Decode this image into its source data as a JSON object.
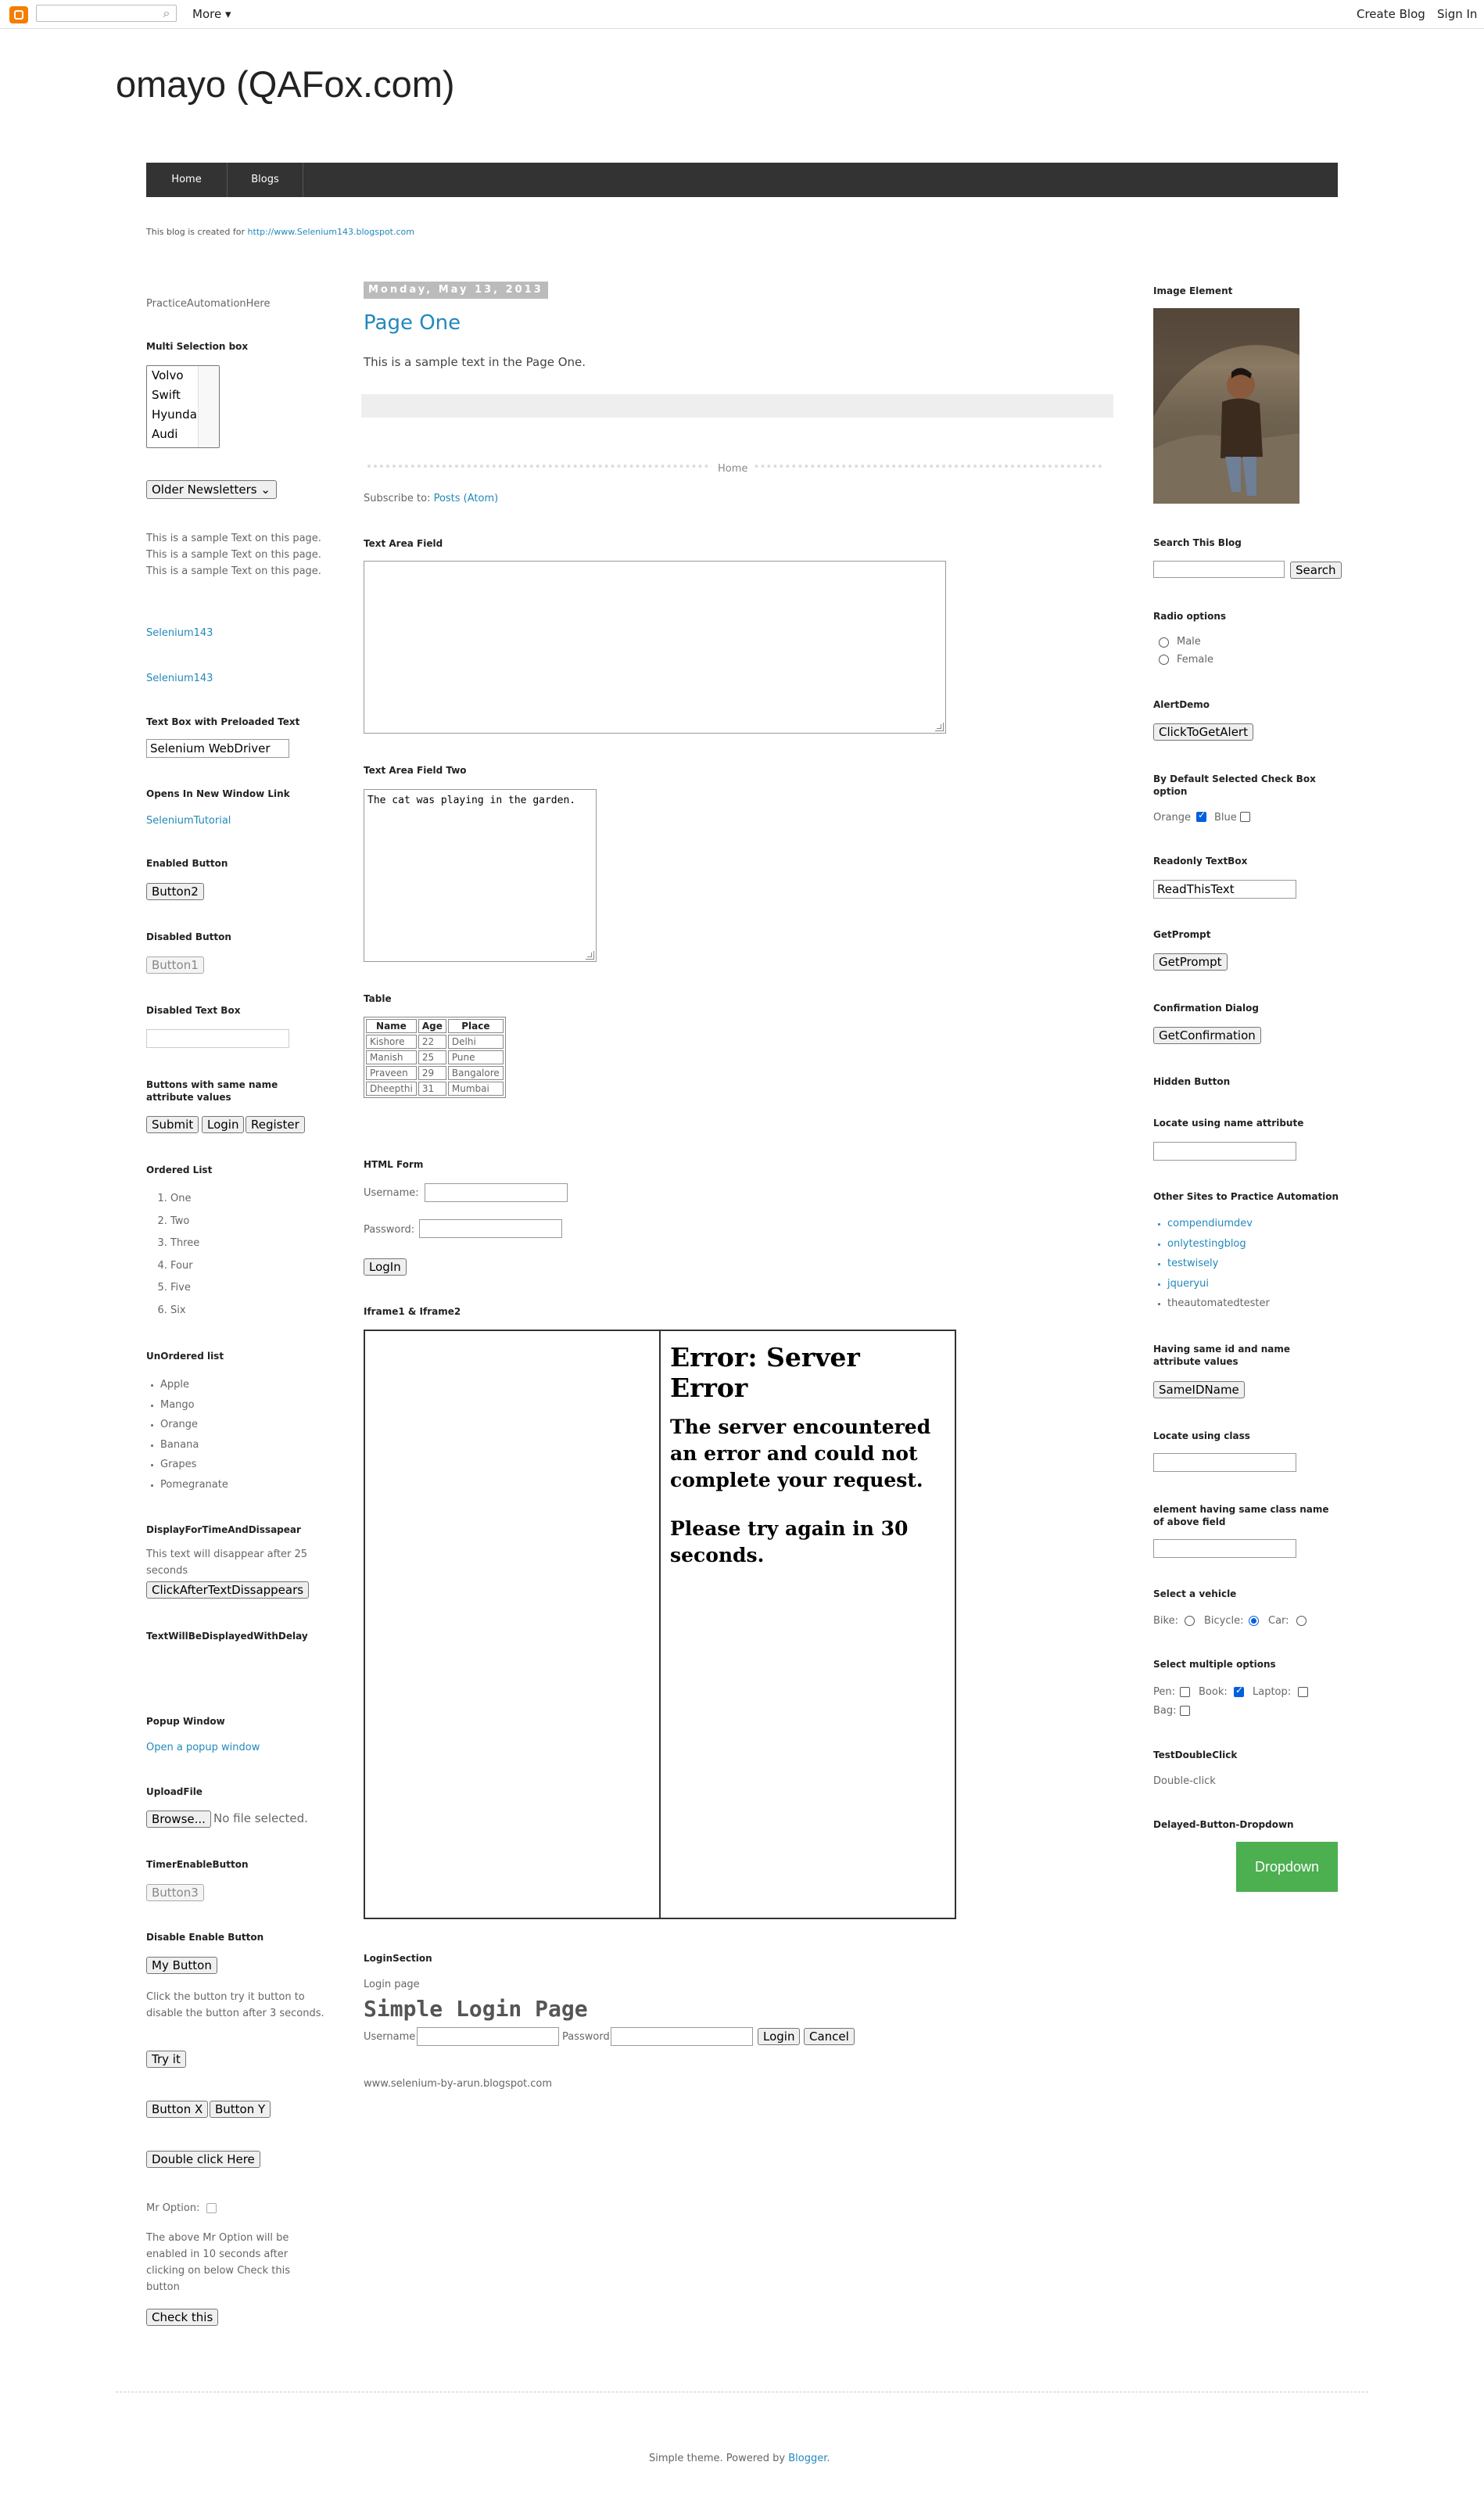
{
  "navbar": {
    "more": "More ▾",
    "create_blog": "Create Blog",
    "sign_in": "Sign In"
  },
  "header": {
    "title": "omayo (QAFox.com)"
  },
  "tabs": [
    {
      "label": "Home"
    },
    {
      "label": "Blogs"
    }
  ],
  "description": {
    "text": "This blog is created for ",
    "link": "http://www.Selenium143.blogspot.com"
  },
  "left": {
    "practice": "PracticeAutomationHere",
    "multi_select": {
      "heading": "Multi Selection box",
      "options": [
        "Volvo",
        "Swift",
        "Hyundai",
        "Audi"
      ]
    },
    "newsletters": "Older Newsletters",
    "sample_text": "This is a sample Text on this page. This is a sample Text on this page. This is a sample Text on this page.",
    "selenium143_a": "Selenium143",
    "selenium143_b": "Selenium143",
    "preloaded": {
      "heading": "Text Box with Preloaded Text",
      "value": "Selenium WebDriver"
    },
    "new_window": {
      "heading": "Opens In New Window Link",
      "link": "SeleniumTutorial"
    },
    "enabled": {
      "heading": "Enabled Button",
      "button": "Button2"
    },
    "disabled": {
      "heading": "Disabled Button",
      "button": "Button1"
    },
    "disabled_text": {
      "heading": "Disabled Text Box"
    },
    "same_name": {
      "heading": "Buttons with same name attribute values",
      "buttons": [
        "Submit",
        "Login",
        "Register"
      ]
    },
    "ordered": {
      "heading": "Ordered List",
      "items": [
        "One",
        "Two",
        "Three",
        "Four",
        "Five",
        "Six"
      ]
    },
    "unordered": {
      "heading": "UnOrdered list",
      "items": [
        "Apple",
        "Mango",
        "Orange",
        "Banana",
        "Grapes",
        "Pomegranate"
      ]
    },
    "disappear": {
      "heading": "DisplayForTimeAndDissapear",
      "text": "This text will disappear after 25 seconds",
      "button": "ClickAfterTextDissappears"
    },
    "delay": {
      "heading": "TextWillBeDisplayedWithDelay"
    },
    "popup": {
      "heading": "Popup Window",
      "link": "Open a popup window"
    },
    "upload": {
      "heading": "UploadFile",
      "button": "Browse...",
      "status": "No file selected."
    },
    "timer": {
      "heading": "TimerEnableButton",
      "button": "Button3"
    },
    "disable_enable": {
      "heading": "Disable Enable Button",
      "button": "My Button",
      "text": "Click the button try it button to disable the button after 3 seconds.",
      "try": "Try it"
    },
    "xy": [
      "Button X",
      "Button Y"
    ],
    "double_click": "Double click Here",
    "mr_option": "Mr Option:",
    "mr_text": "The above Mr Option will be enabled in 10 seconds after clicking on below Check this button",
    "check_this": "Check this"
  },
  "main": {
    "date": "Monday, May 13, 2013",
    "post_title": "Page One",
    "post_body": "This is a sample text in the Page One.",
    "home": "Home",
    "subscribe": "Subscribe to: ",
    "posts_atom": "Posts (Atom)",
    "textarea1": {
      "heading": "Text Area Field"
    },
    "textarea2": {
      "heading": "Text Area Field Two",
      "value": "The cat was playing in the garden."
    },
    "table": {
      "heading": "Table",
      "columns": [
        "Name",
        "Age",
        "Place"
      ],
      "rows": [
        [
          "Kishore",
          "22",
          "Delhi"
        ],
        [
          "Manish",
          "25",
          "Pune"
        ],
        [
          "Praveen",
          "29",
          "Bangalore"
        ],
        [
          "Dheepthi",
          "31",
          "Mumbai"
        ]
      ]
    },
    "form": {
      "heading": "HTML Form",
      "username": "Username:",
      "password": "Password:",
      "button": "LogIn"
    },
    "iframes": {
      "heading": "Iframe1 & Iframe2",
      "error_title": "Error: Server Error",
      "error_body": "The server encountered an error and could not complete your request.",
      "error_retry": "Please try again in 30 seconds."
    },
    "login_section": {
      "heading": "LoginSection",
      "label": "Login page",
      "title": "Simple Login Page",
      "username": "Username",
      "password": "Password",
      "login": "Login",
      "cancel": "Cancel"
    },
    "url": "www.selenium-by-arun.blogspot.com"
  },
  "right": {
    "image": {
      "heading": "Image Element"
    },
    "search": {
      "heading": "Search This Blog",
      "button": "Search"
    },
    "radio": {
      "heading": "Radio options",
      "male": "Male",
      "female": "Female"
    },
    "alert": {
      "heading": "AlertDemo",
      "button": "ClickToGetAlert"
    },
    "default_check": {
      "heading": "By Default Selected Check Box option",
      "orange": "Orange",
      "blue": "Blue"
    },
    "readonly": {
      "heading": "Readonly TextBox",
      "value": "ReadThisText"
    },
    "prompt": {
      "heading": "GetPrompt",
      "button": "GetPrompt"
    },
    "confirm": {
      "heading": "Confirmation Dialog",
      "button": "GetConfirmation"
    },
    "hidden": {
      "heading": "Hidden Button"
    },
    "locate_name": {
      "heading": "Locate using name attribute"
    },
    "other_sites": {
      "heading": "Other Sites to Practice Automation",
      "links": [
        "compendiumdev",
        "onlytestingblog",
        "testwisely",
        "jqueryui"
      ],
      "plain": "theautomatedtester"
    },
    "same_id": {
      "heading": "Having same id and name attribute values",
      "button": "SameIDName"
    },
    "locate_class": {
      "heading": "Locate using class"
    },
    "same_class": {
      "heading": "element having same class name of above field"
    },
    "vehicle": {
      "heading": "Select a vehicle",
      "bike": "Bike:",
      "bicycle": "Bicycle:",
      "car": "Car:"
    },
    "multiple": {
      "heading": "Select multiple options",
      "pen": "Pen:",
      "book": "Book:",
      "laptop": "Laptop:",
      "bag": "Bag:"
    },
    "dbl": {
      "heading": "TestDoubleClick",
      "text": "Double-click"
    },
    "delayed": {
      "heading": "Delayed-Button-Dropdown",
      "button": "Dropdown"
    }
  },
  "footer": {
    "text": "Simple theme. Powered by ",
    "link": "Blogger",
    "end": "."
  }
}
